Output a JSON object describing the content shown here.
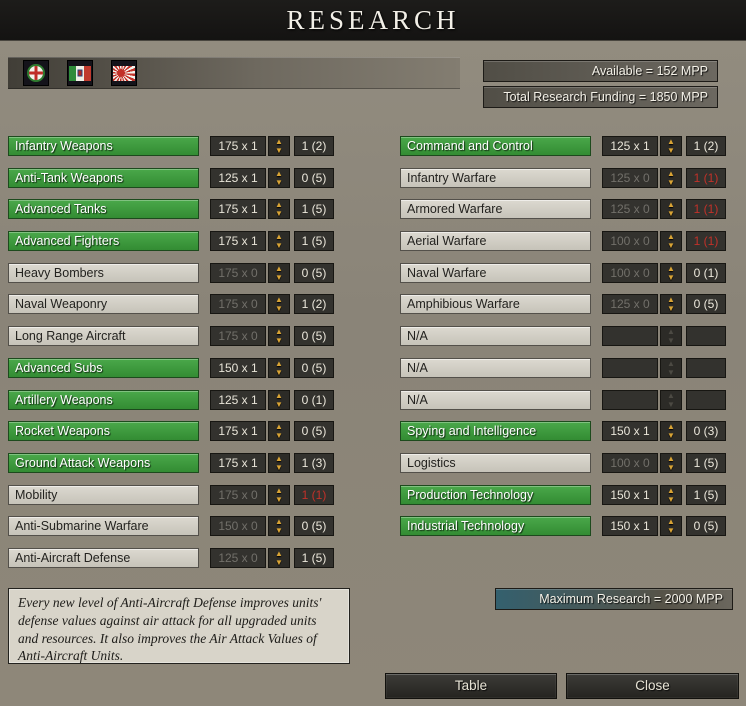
{
  "title": "RESEARCH",
  "header": {
    "available": "Available =  152 MPP",
    "funding": "Total Research Funding =  1850 MPP",
    "flags": [
      "italian-roundel",
      "kingdom-of-italy-flag",
      "japan-rising-sun-flag"
    ]
  },
  "colors": {
    "active_green": "#3f9b3f",
    "arrow_gold": "#d9a435",
    "maxed_red": "#c23129",
    "max_box_teal": "#34606e"
  },
  "left_rows": [
    {
      "label": "Infantry Weapons",
      "cost": "175 x 1",
      "count": "1 (2)",
      "active": true,
      "maxed": false
    },
    {
      "label": "Anti-Tank Weapons",
      "cost": "125 x 1",
      "count": "0 (5)",
      "active": true,
      "maxed": false
    },
    {
      "label": "Advanced Tanks",
      "cost": "175 x 1",
      "count": "1 (5)",
      "active": true,
      "maxed": false
    },
    {
      "label": "Advanced Fighters",
      "cost": "175 x 1",
      "count": "1 (5)",
      "active": true,
      "maxed": false
    },
    {
      "label": "Heavy Bombers",
      "cost": "175 x 0",
      "count": "0 (5)",
      "active": false,
      "maxed": false
    },
    {
      "label": "Naval Weaponry",
      "cost": "175 x 0",
      "count": "1 (2)",
      "active": false,
      "maxed": false
    },
    {
      "label": "Long Range Aircraft",
      "cost": "175 x 0",
      "count": "0 (5)",
      "active": false,
      "maxed": false
    },
    {
      "label": "Advanced Subs",
      "cost": "150 x 1",
      "count": "0 (5)",
      "active": true,
      "maxed": false
    },
    {
      "label": "Artillery Weapons",
      "cost": "125 x 1",
      "count": "0 (1)",
      "active": true,
      "maxed": false
    },
    {
      "label": "Rocket Weapons",
      "cost": "175 x 1",
      "count": "0 (5)",
      "active": true,
      "maxed": false
    },
    {
      "label": "Ground Attack Weapons",
      "cost": "175 x 1",
      "count": "1 (3)",
      "active": true,
      "maxed": false
    },
    {
      "label": "Mobility",
      "cost": "175 x 0",
      "count": "1 (1)",
      "active": false,
      "maxed": true
    },
    {
      "label": "Anti-Submarine Warfare",
      "cost": "150 x 0",
      "count": "0 (5)",
      "active": false,
      "maxed": false
    },
    {
      "label": "Anti-Aircraft Defense",
      "cost": "125 x 0",
      "count": "1 (5)",
      "active": false,
      "maxed": false
    }
  ],
  "right_rows": [
    {
      "label": "Command and Control",
      "cost": "125 x 1",
      "count": "1 (2)",
      "active": true,
      "maxed": false
    },
    {
      "label": "Infantry Warfare",
      "cost": "125 x 0",
      "count": "1 (1)",
      "active": false,
      "maxed": true
    },
    {
      "label": "Armored Warfare",
      "cost": "125 x 0",
      "count": "1 (1)",
      "active": false,
      "maxed": true
    },
    {
      "label": "Aerial Warfare",
      "cost": "100 x 0",
      "count": "1 (1)",
      "active": false,
      "maxed": true
    },
    {
      "label": "Naval Warfare",
      "cost": "100 x 0",
      "count": "0 (1)",
      "active": false,
      "maxed": false
    },
    {
      "label": "Amphibious Warfare",
      "cost": "125 x 0",
      "count": "0 (5)",
      "active": false,
      "maxed": false
    },
    {
      "label": "N/A",
      "cost": "",
      "count": "",
      "active": false,
      "maxed": false,
      "na": true
    },
    {
      "label": "N/A",
      "cost": "",
      "count": "",
      "active": false,
      "maxed": false,
      "na": true
    },
    {
      "label": "N/A",
      "cost": "",
      "count": "",
      "active": false,
      "maxed": false,
      "na": true
    },
    {
      "label": "Spying and Intelligence",
      "cost": "150 x 1",
      "count": "0 (3)",
      "active": true,
      "maxed": false
    },
    {
      "label": "Logistics",
      "cost": "100 x 0",
      "count": "1 (5)",
      "active": false,
      "maxed": false
    },
    {
      "label": "Production Technology",
      "cost": "150 x 1",
      "count": "1 (5)",
      "active": true,
      "maxed": false
    },
    {
      "label": "Industrial Technology",
      "cost": "150 x 1",
      "count": "0 (5)",
      "active": true,
      "maxed": false
    }
  ],
  "description": "Every new level of Anti-Aircraft Defense improves units' defense values against air attack for all upgraded units and resources. It also improves the Air Attack Values of Anti-Aircraft Units.",
  "maximum": "Maximum Research =  2000 MPP",
  "buttons": {
    "table": "Table",
    "close": "Close"
  }
}
